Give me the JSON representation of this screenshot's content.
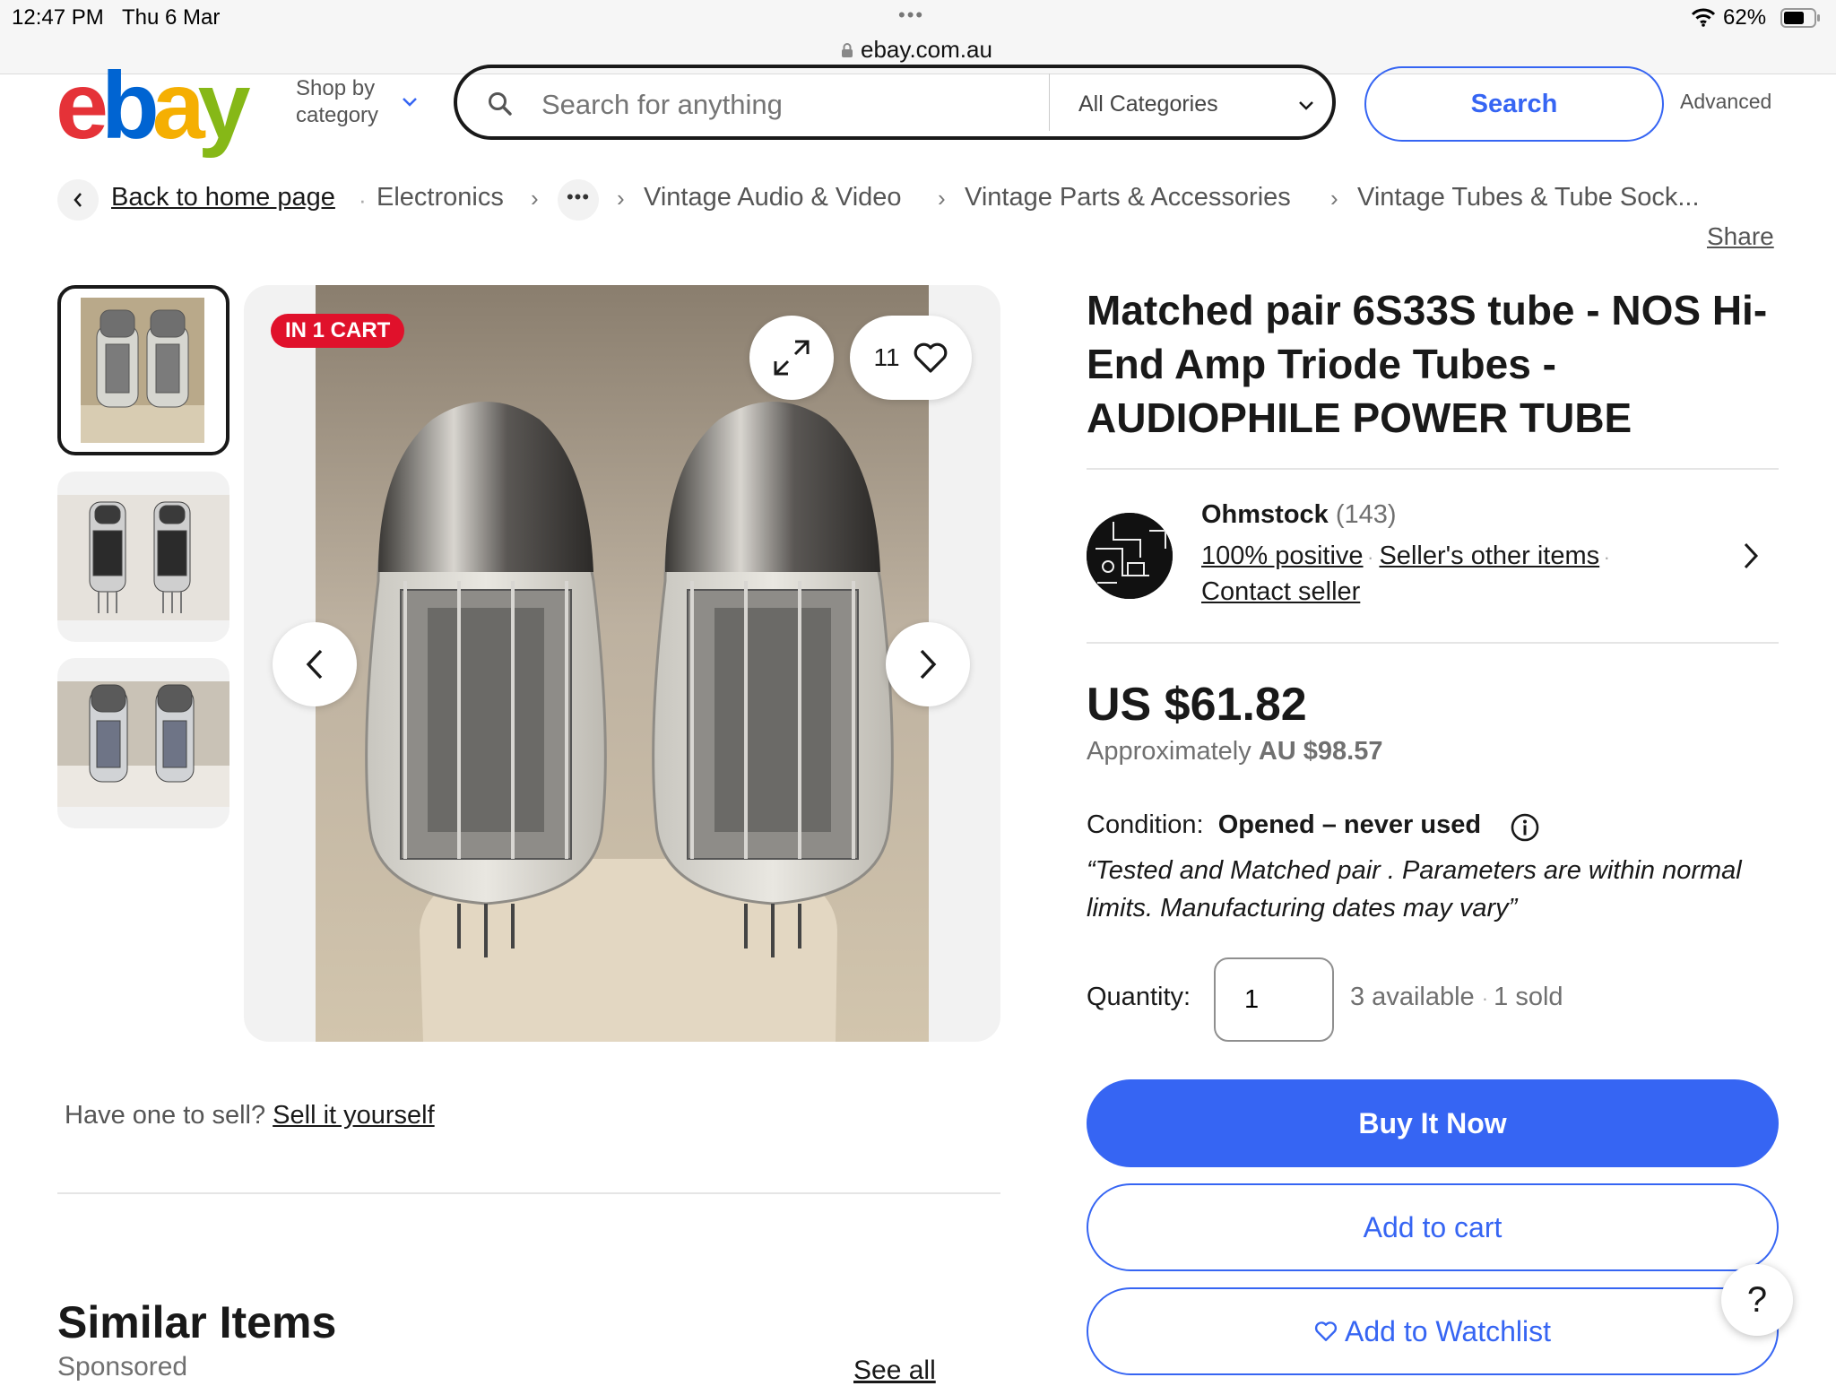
{
  "status_bar": {
    "time": "12:47 PM",
    "date": "Thu 6 Mar",
    "url": "ebay.com.au",
    "battery": "62%"
  },
  "header": {
    "logo": {
      "letters": [
        "e",
        "b",
        "a",
        "y"
      ],
      "colors": [
        "#e53238",
        "#0064d2",
        "#f5af02",
        "#86b817"
      ]
    },
    "shop_by_line1": "Shop by",
    "shop_by_line2": "category",
    "search_placeholder": "Search for anything",
    "category_select": "All Categories",
    "search_button": "Search",
    "advanced": "Advanced"
  },
  "breadcrumb": {
    "back": "Back to home page",
    "items": [
      "Electronics",
      "Vintage Audio & Video",
      "Vintage Parts & Accessories",
      "Vintage Tubes & Tube Sock..."
    ]
  },
  "share": "Share",
  "gallery": {
    "badge": "IN 1 CART",
    "watch_count": "11",
    "thumbnail_count": 3
  },
  "sell": {
    "prompt": "Have one to sell?",
    "link": "Sell it yourself"
  },
  "similar": {
    "title": "Similar Items",
    "sponsored": "Sponsored",
    "see_all": "See all"
  },
  "listing": {
    "title": "Matched pair 6S33S tube - NOS Hi-End Amp Triode Tubes - AUDIOPHILE POWER TUBE",
    "seller": {
      "name": "Ohmstock",
      "count": "(143)",
      "positive": "100% positive",
      "other_items": "Seller's other items",
      "contact": "Contact seller"
    },
    "price": "US $61.82",
    "approx_prefix": "Approximately",
    "approx_value": "AU $98.57",
    "condition_label": "Condition:",
    "condition_value": "Opened – never used",
    "condition_quote": "“Tested and Matched pair . Parameters are within normal limits. Manufacturing dates may vary”",
    "quantity_label": "Quantity:",
    "quantity_value": "1",
    "available": "3 available",
    "sold": "1 sold",
    "buy_now": "Buy It Now",
    "add_to_cart": "Add to cart",
    "add_to_watchlist": "Add to Watchlist"
  },
  "help": "?",
  "colors": {
    "accent": "#3665f3",
    "badge": "#e0112b"
  }
}
